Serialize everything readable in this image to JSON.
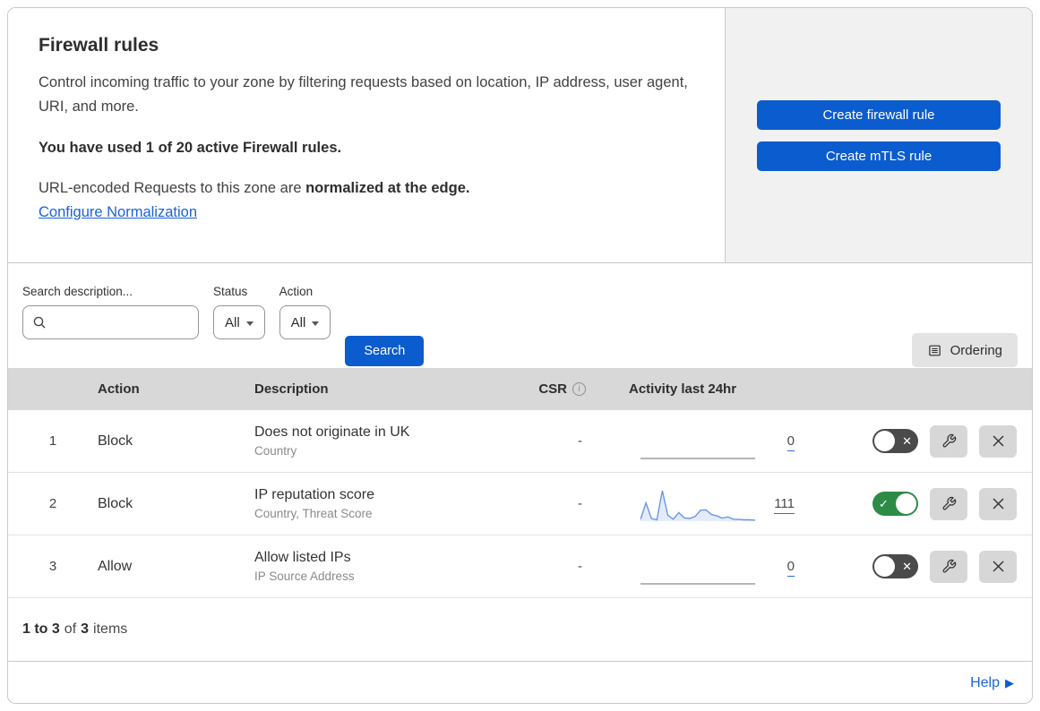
{
  "header": {
    "title": "Firewall rules",
    "description": "Control incoming traffic to your zone by filtering requests based on location, IP address, user agent, URI, and more.",
    "usage_text": "You have used 1 of 20 active Firewall rules.",
    "normalization_prefix": "URL-encoded Requests to this zone are ",
    "normalization_bold": "normalized at the edge.",
    "normalization_link": "Configure Normalization",
    "create_firewall_button": "Create firewall rule",
    "create_mtls_button": "Create mTLS rule"
  },
  "filters": {
    "search_label": "Search description...",
    "search_value": "",
    "status_label": "Status",
    "status_value": "All",
    "action_label": "Action",
    "action_value": "All",
    "search_button": "Search",
    "ordering_button": "Ordering"
  },
  "table": {
    "columns": {
      "action": "Action",
      "description": "Description",
      "csr": "CSR",
      "activity": "Activity last 24hr"
    },
    "rows": [
      {
        "index": "1",
        "action": "Block",
        "description": "Does not originate in UK",
        "fields": "Country",
        "csr": "-",
        "activity_count": "0",
        "enabled": false,
        "sparkline": [
          0,
          0,
          0,
          0,
          0,
          0,
          0,
          0,
          0,
          0,
          0,
          0,
          0,
          0,
          0,
          0,
          0,
          0,
          0,
          0,
          0,
          0
        ]
      },
      {
        "index": "2",
        "action": "Block",
        "description": "IP reputation score",
        "fields": "Country, Threat Score",
        "csr": "-",
        "activity_count": "111",
        "enabled": true,
        "sparkline": [
          5,
          55,
          8,
          4,
          92,
          18,
          6,
          26,
          10,
          8,
          14,
          33,
          34,
          20,
          16,
          9,
          13,
          6,
          5,
          4,
          4,
          3
        ]
      },
      {
        "index": "3",
        "action": "Allow",
        "description": "Allow listed IPs",
        "fields": "IP Source Address",
        "csr": "-",
        "activity_count": "0",
        "enabled": false,
        "sparkline": [
          0,
          0,
          0,
          0,
          0,
          0,
          0,
          0,
          0,
          0,
          0,
          0,
          0,
          0,
          0,
          0,
          0,
          0,
          0,
          0,
          0,
          0
        ]
      }
    ],
    "footer": {
      "range": "1 to 3",
      "of_text": "of",
      "total": "3",
      "items_text": "items"
    }
  },
  "help": {
    "label": "Help"
  },
  "chart_data": {
    "type": "area",
    "title": "Activity last 24hr sparkline (rule 2: IP reputation score)",
    "x": [
      1,
      2,
      3,
      4,
      5,
      6,
      7,
      8,
      9,
      10,
      11,
      12,
      13,
      14,
      15,
      16,
      17,
      18,
      19,
      20,
      21,
      22
    ],
    "values": [
      5,
      55,
      8,
      4,
      92,
      18,
      6,
      26,
      10,
      8,
      14,
      33,
      34,
      20,
      16,
      9,
      13,
      6,
      5,
      4,
      4,
      3
    ],
    "ylim": [
      0,
      100
    ],
    "total_events": 111
  },
  "colors": {
    "accent_blue": "#0b5cce",
    "link_blue": "#1a62d6",
    "toggle_on_green": "#2d8b45",
    "toggle_off_gray": "#4a4a4a",
    "panel_gray": "#f1f1f1",
    "table_header_gray": "#d8d8d8",
    "spark_line_blue": "#6c96e8",
    "spark_flat_gray": "#9e9e9e"
  }
}
